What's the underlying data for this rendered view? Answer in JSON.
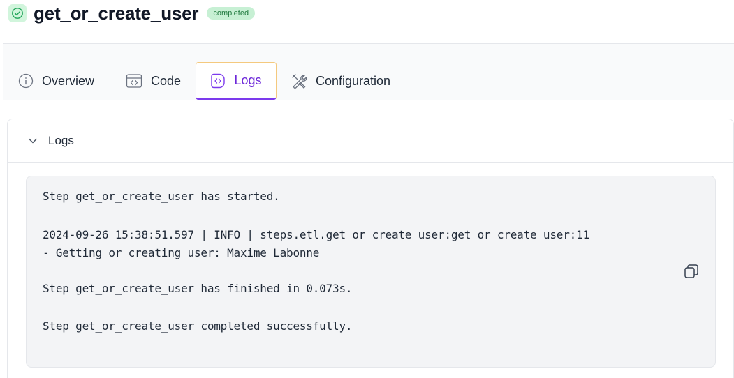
{
  "header": {
    "step_name": "get_or_create_user",
    "status": "completed"
  },
  "tabs": [
    {
      "label": "Overview",
      "icon": "info-icon",
      "active": false
    },
    {
      "label": "Code",
      "icon": "code-icon",
      "active": false
    },
    {
      "label": "Logs",
      "icon": "logs-icon",
      "active": true
    },
    {
      "label": "Configuration",
      "icon": "tools-icon",
      "active": false
    }
  ],
  "logs_section": {
    "title": "Logs",
    "lines": [
      "Step get_or_create_user has started.",
      "2024-09-26 15:38:51.597 | INFO | steps.etl.get_or_create_user:get_or_create_user:11",
      "- Getting or creating user: Maxime Labonne",
      "Step get_or_create_user has finished in 0.073s.",
      "Step get_or_create_user completed successfully."
    ]
  },
  "colors": {
    "active_tab": "#6d28d9",
    "status_badge_bg": "#c7f0d4",
    "status_icon": "#22a55a"
  }
}
